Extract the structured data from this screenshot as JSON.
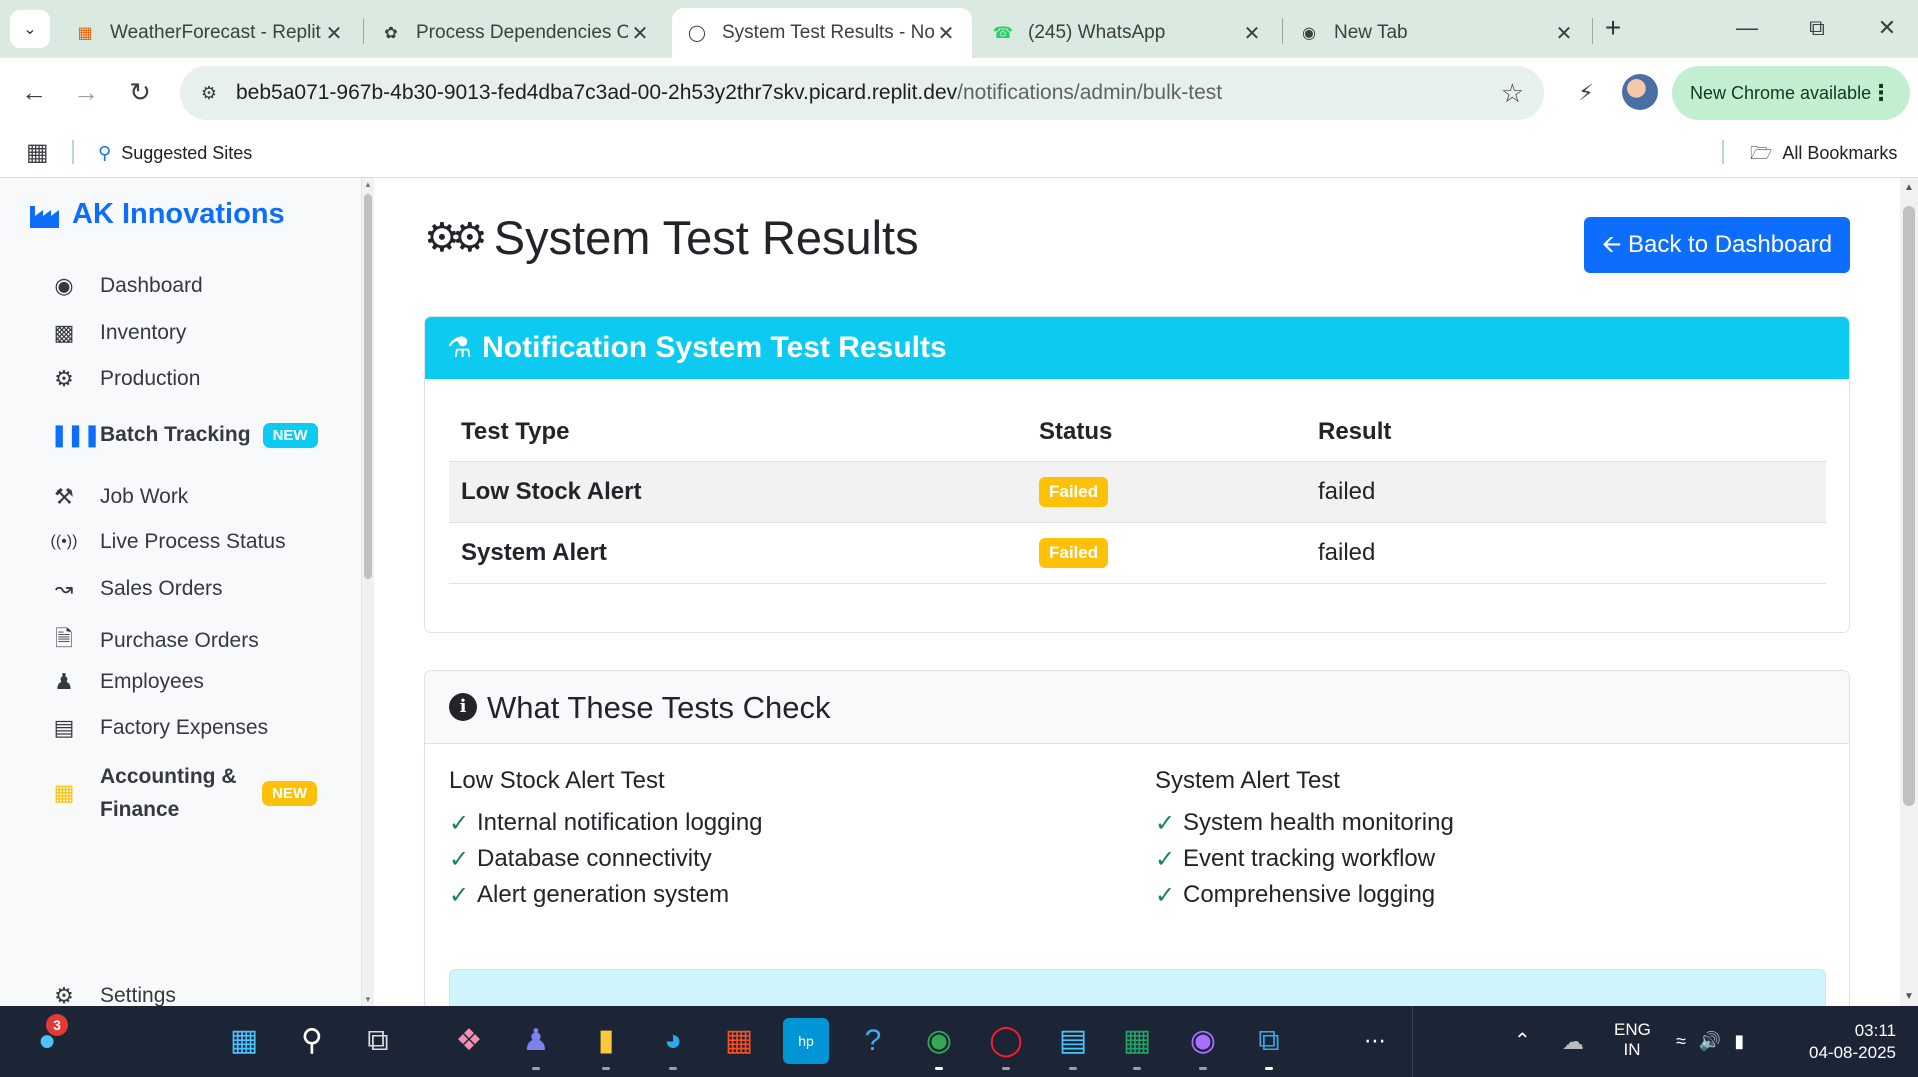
{
  "browser": {
    "tabs": [
      {
        "title": "WeatherForecast - Replit",
        "icon": "replit-icon",
        "active": false
      },
      {
        "title": "Process Dependencies O",
        "icon": "openai-icon",
        "active": false
      },
      {
        "title": "System Test Results - Not",
        "icon": "globe-icon",
        "active": true
      },
      {
        "title": "(245) WhatsApp",
        "icon": "whatsapp-icon",
        "active": false
      },
      {
        "title": "New Tab",
        "icon": "chrome-icon",
        "active": false
      }
    ],
    "url_host": "beb5a071-967b-4b30-9013-fed4dba7c3ad-00-2h53y2thr7skv.picard.replit.dev",
    "url_path": "/notifications/admin/bulk-test",
    "new_chrome_label": "New Chrome available",
    "bookmarks": {
      "suggested_sites": "Suggested Sites",
      "all_bookmarks": "All Bookmarks"
    }
  },
  "sidebar": {
    "brand": "AK Innovations",
    "items": [
      {
        "label": "Dashboard",
        "icon": "palette-icon",
        "badge": ""
      },
      {
        "label": "Inventory",
        "icon": "boxes-icon",
        "badge": ""
      },
      {
        "label": "Production",
        "icon": "cogs-icon",
        "badge": ""
      },
      {
        "label": "Batch Tracking",
        "icon": "barcode-icon",
        "badge": "NEW"
      },
      {
        "label": "Job Work",
        "icon": "tools-icon",
        "badge": ""
      },
      {
        "label": "Live Process Status",
        "icon": "broadcast-icon",
        "badge": ""
      },
      {
        "label": "Sales Orders",
        "icon": "chart-line-icon",
        "badge": ""
      },
      {
        "label": "Purchase Orders",
        "icon": "file-invoice-icon",
        "badge": ""
      },
      {
        "label": "Employees",
        "icon": "users-icon",
        "badge": ""
      },
      {
        "label": "Factory Expenses",
        "icon": "receipt-icon",
        "badge": ""
      },
      {
        "label": "Accounting &",
        "label2": "Finance",
        "icon": "calculator-icon",
        "badge": "NEW"
      },
      {
        "label": "Settings",
        "icon": "gear-icon",
        "badge": ""
      }
    ]
  },
  "main": {
    "title": "System Test Results",
    "back_button": "Back to Dashboard",
    "results_card": {
      "header": "Notification System Test Results",
      "columns": [
        "Test Type",
        "Status",
        "Result"
      ],
      "rows": [
        {
          "type": "Low Stock Alert",
          "status": "Failed",
          "result": "failed"
        },
        {
          "type": "System Alert",
          "status": "Failed",
          "result": "failed"
        }
      ]
    },
    "info_card": {
      "header": "What These Tests Check",
      "left": {
        "title": "Low Stock Alert Test",
        "items": [
          "Internal notification logging",
          "Database connectivity",
          "Alert generation system"
        ]
      },
      "right": {
        "title": "System Alert Test",
        "items": [
          "System health monitoring",
          "Event tracking workflow",
          "Comprehensive logging"
        ]
      }
    }
  },
  "taskbar": {
    "notification_count": "3",
    "lang_line1": "ENG",
    "lang_line2": "IN",
    "time": "03:11",
    "date": "04-08-2025"
  },
  "colors": {
    "primary": "#0d6efd",
    "info": "#0dcaf0",
    "warning": "#ffc107",
    "success": "#198754"
  }
}
